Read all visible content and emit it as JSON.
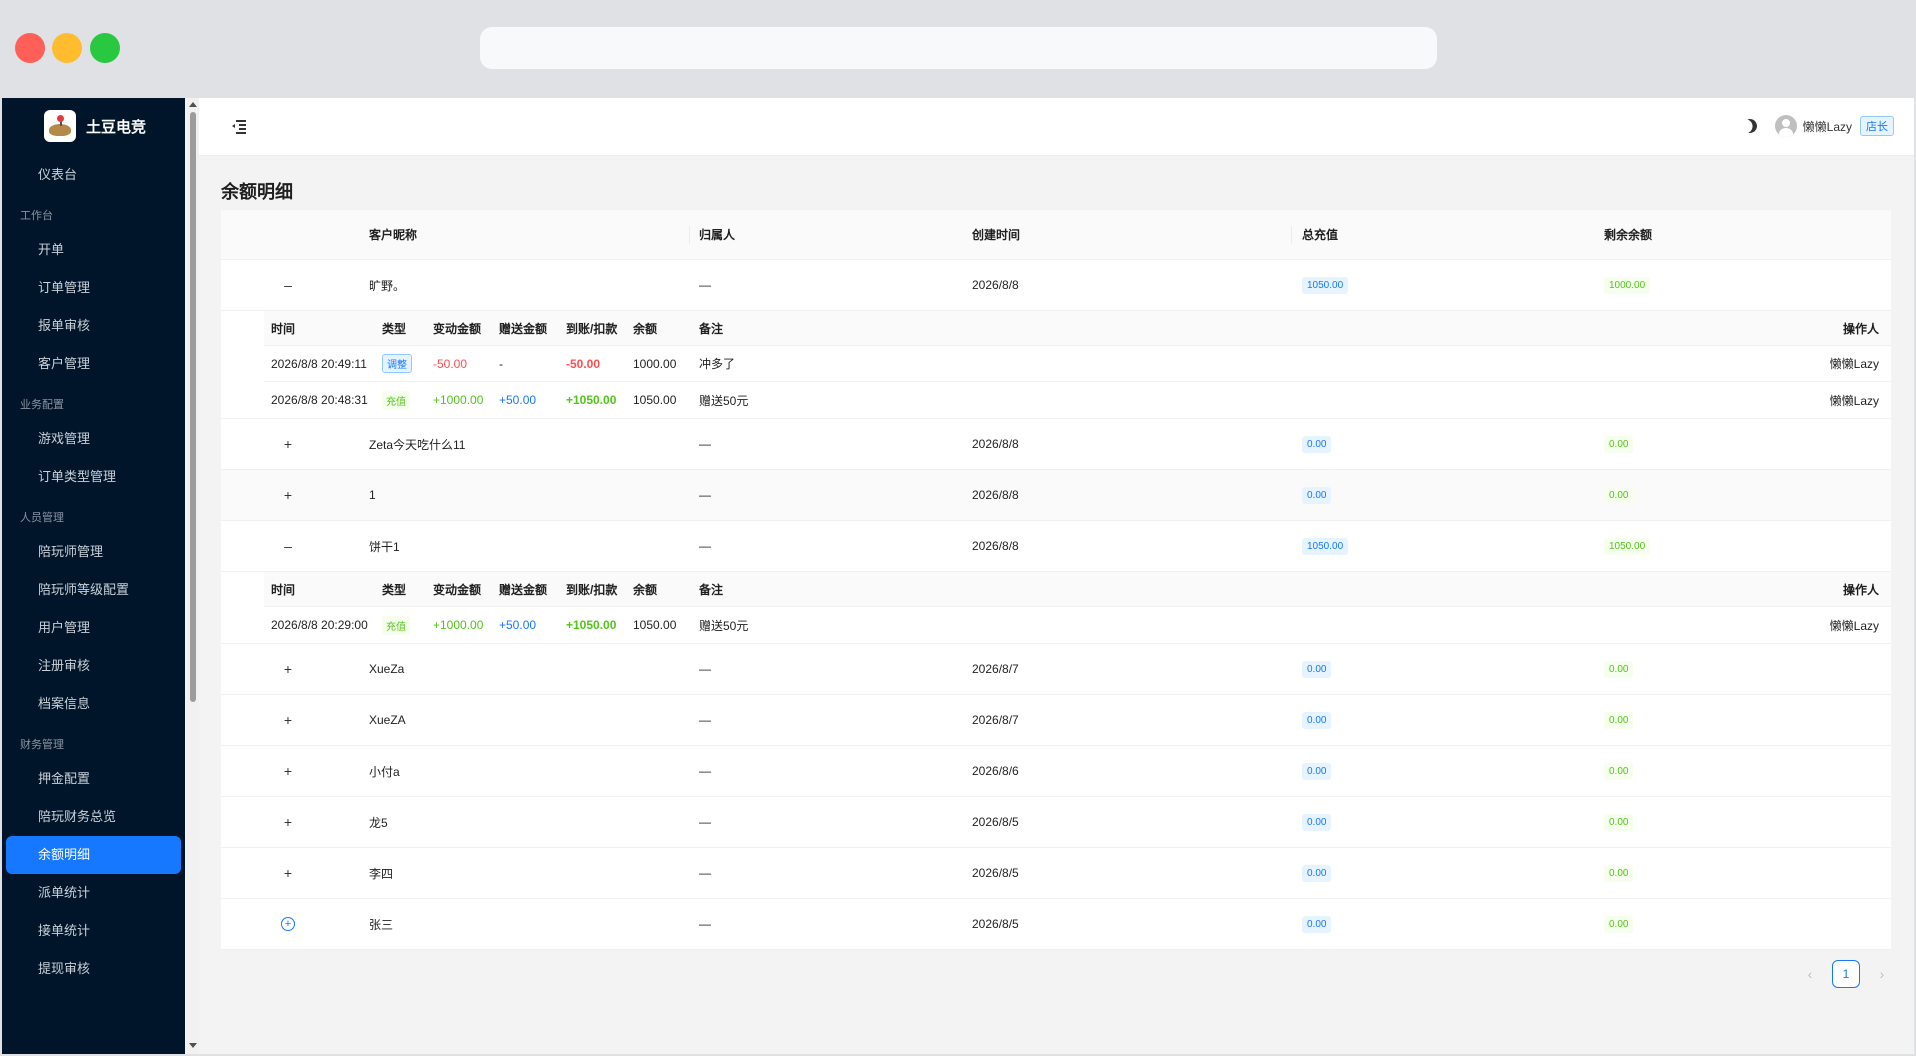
{
  "sidebar": {
    "logo_text": "土豆电竞",
    "dashboard": "仪表台",
    "groups": {
      "workbench": {
        "title": "工作台",
        "items": [
          "开单",
          "订单管理",
          "报单审核",
          "客户管理"
        ]
      },
      "business": {
        "title": "业务配置",
        "items": [
          "游戏管理",
          "订单类型管理"
        ]
      },
      "people": {
        "title": "人员管理",
        "items": [
          "陪玩师管理",
          "陪玩师等级配置",
          "用户管理",
          "注册审核",
          "档案信息"
        ]
      },
      "finance": {
        "title": "财务管理",
        "items": [
          "押金配置",
          "陪玩财务总览",
          "余额明细",
          "派单统计",
          "接单统计",
          "提现审核"
        ]
      }
    },
    "active": "余额明细"
  },
  "header": {
    "username": "懒懒Lazy",
    "role": "店长",
    "icons": {
      "toggle": "menu-fold-icon",
      "theme": "moon-icon",
      "avatar": "user-avatar-icon"
    }
  },
  "page": {
    "title": "余额明细"
  },
  "table": {
    "columns": {
      "nickname": "客户昵称",
      "owner": "归属人",
      "created": "创建时间",
      "total": "总充值",
      "remaining": "剩余余额"
    },
    "sub_columns": {
      "time": "时间",
      "type": "类型",
      "change": "变动金额",
      "gift": "赠送金额",
      "net": "到账/扣款",
      "balance": "余额",
      "note": "备注",
      "operator": "操作人"
    },
    "rows": [
      {
        "expand": "–",
        "nickname": "旷野。",
        "owner": "—",
        "created": "2026/8/8",
        "total": "1050.00",
        "remaining": "1000.00",
        "details": [
          {
            "time": "2026/8/8 20:49:11",
            "type": "调整",
            "change": "-50.00",
            "gift": "-",
            "net": "-50.00",
            "balance": "1000.00",
            "note": "冲多了",
            "operator": "懒懒Lazy"
          },
          {
            "time": "2026/8/8 20:48:31",
            "type": "充值",
            "change": "+1000.00",
            "gift": "+50.00",
            "net": "+1050.00",
            "balance": "1050.00",
            "note": "赠送50元",
            "operator": "懒懒Lazy"
          }
        ]
      },
      {
        "expand": "+",
        "nickname": "Zeta今天吃什么11",
        "owner": "—",
        "created": "2026/8/8",
        "total": "0.00",
        "remaining": "0.00"
      },
      {
        "expand": "+",
        "nickname": "1",
        "owner": "—",
        "created": "2026/8/8",
        "total": "0.00",
        "remaining": "0.00"
      },
      {
        "expand": "–",
        "nickname": "饼干1",
        "owner": "—",
        "created": "2026/8/8",
        "total": "1050.00",
        "remaining": "1050.00",
        "details": [
          {
            "time": "2026/8/8 20:29:00",
            "type": "充值",
            "change": "+1000.00",
            "gift": "+50.00",
            "net": "+1050.00",
            "balance": "1050.00",
            "note": "赠送50元",
            "operator": "懒懒Lazy"
          }
        ]
      },
      {
        "expand": "+",
        "nickname": "XueZa",
        "owner": "—",
        "created": "2026/8/7",
        "total": "0.00",
        "remaining": "0.00"
      },
      {
        "expand": "+",
        "nickname": "XueZA",
        "owner": "—",
        "created": "2026/8/7",
        "total": "0.00",
        "remaining": "0.00"
      },
      {
        "expand": "+",
        "nickname": "小付a",
        "owner": "—",
        "created": "2026/8/6",
        "total": "0.00",
        "remaining": "0.00"
      },
      {
        "expand": "+",
        "nickname": "龙5",
        "owner": "—",
        "created": "2026/8/5",
        "total": "0.00",
        "remaining": "0.00"
      },
      {
        "expand": "+",
        "nickname": "李四",
        "owner": "—",
        "created": "2026/8/5",
        "total": "0.00",
        "remaining": "0.00"
      },
      {
        "expand": "+",
        "nickname": "张三",
        "owner": "—",
        "created": "2026/8/5",
        "total": "0.00",
        "remaining": "0.00"
      }
    ]
  },
  "pagination": {
    "current": "1",
    "prev": "‹",
    "next": "›"
  }
}
